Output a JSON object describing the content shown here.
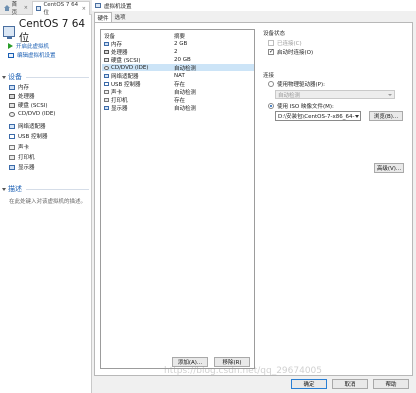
{
  "vmware": {
    "tabs": [
      {
        "label": "首页"
      },
      {
        "label": "CentOS 7 64 位"
      }
    ],
    "close_glyph": "×",
    "vm_title": "CentOS 7 64 位",
    "actions": {
      "power_on": "开启此虚拟机",
      "edit_settings": "编辑虚拟机设置"
    },
    "devices_section": "设备",
    "devices": [
      {
        "label": "内存",
        "icon": "memory-icon"
      },
      {
        "label": "处理器",
        "icon": "cpu-icon"
      },
      {
        "label": "硬盘 (SCSI)",
        "icon": "hard-disk-icon"
      },
      {
        "label": "CD/DVD (IDE)",
        "icon": "cd-dvd-icon"
      },
      {
        "label": "网络适配器",
        "icon": "network-icon"
      },
      {
        "label": "USB 控制器",
        "icon": "usb-icon"
      },
      {
        "label": "声卡",
        "icon": "sound-icon"
      },
      {
        "label": "打印机",
        "icon": "printer-icon"
      },
      {
        "label": "显示器",
        "icon": "monitor-icon"
      }
    ],
    "description_section": "描述",
    "description_placeholder": "在此处键入对该虚拟机的描述。"
  },
  "dialog": {
    "title": "虚拟机设置",
    "tabs": {
      "hardware": "硬件",
      "options": "选项"
    },
    "list_headers": {
      "device": "设备",
      "summary": "摘要"
    },
    "devices": [
      {
        "name": "内存",
        "summary": "2 GB",
        "icon": "memory-icon",
        "selected": false
      },
      {
        "name": "处理器",
        "summary": "2",
        "icon": "cpu-icon",
        "selected": false
      },
      {
        "name": "硬盘 (SCSI)",
        "summary": "20 GB",
        "icon": "hard-disk-icon",
        "selected": false
      },
      {
        "name": "CD/DVD (IDE)",
        "summary": "自动检测",
        "icon": "cd-dvd-icon",
        "selected": true
      },
      {
        "name": "网络适配器",
        "summary": "NAT",
        "icon": "network-icon",
        "selected": false
      },
      {
        "name": "USB 控制器",
        "summary": "存在",
        "icon": "usb-icon",
        "selected": false
      },
      {
        "name": "声卡",
        "summary": "自动检测",
        "icon": "sound-icon",
        "selected": false
      },
      {
        "name": "打印机",
        "summary": "存在",
        "icon": "printer-icon",
        "selected": false
      },
      {
        "name": "显示器",
        "summary": "自动检测",
        "icon": "monitor-icon",
        "selected": false
      }
    ],
    "device_status": {
      "title": "设备状态",
      "connected": "已连接(C)",
      "connect_at_power_on": "启动时连接(O)",
      "connected_checked": false,
      "connect_at_power_on_checked": true
    },
    "connection": {
      "title": "连接",
      "physical_drive": "使用物理驱动器(P):",
      "physical_drive_value": "自动检测",
      "iso_image": "使用 ISO 映像文件(M):",
      "iso_path": "D:\\安装包\\CentOS-7-x86_64-",
      "browse": "浏览(B)...",
      "selected": "iso"
    },
    "advanced": "高级(V)...",
    "add": "添加(A)...",
    "remove": "移除(R)",
    "ok": "确定",
    "cancel": "取消",
    "help": "帮助"
  },
  "watermark": "https://blog.csdn.net/qq_29674005"
}
